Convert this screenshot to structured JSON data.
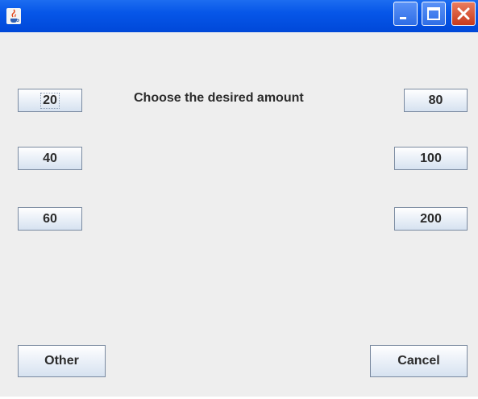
{
  "window": {
    "title": ""
  },
  "icons": {
    "app": "java-coffee-icon",
    "minimize": "minimize-icon",
    "maximize": "maximize-icon",
    "close": "close-icon"
  },
  "prompt": "Choose the desired amount",
  "amounts": {
    "a20": "20",
    "a40": "40",
    "a60": "60",
    "a80": "80",
    "a100": "100",
    "a200": "200"
  },
  "actions": {
    "other": "Other",
    "cancel": "Cancel"
  },
  "colors": {
    "titlebar": "#0656e8",
    "close": "#c83a1c",
    "background": "#eeeeee"
  }
}
